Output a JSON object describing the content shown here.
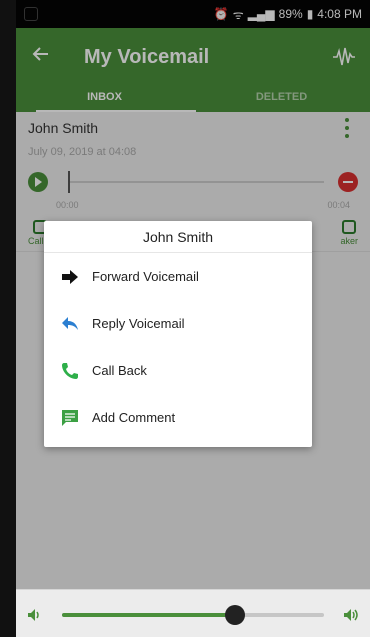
{
  "status_bar": {
    "battery": "89%",
    "time": "4:08 PM"
  },
  "app_bar": {
    "title": "My Voicemail",
    "back_icon": "arrow-left-icon",
    "action_icon": "waveform-icon"
  },
  "tabs": [
    {
      "label": "INBOX",
      "active": true
    },
    {
      "label": "DELETED",
      "active": false
    }
  ],
  "voicemail": {
    "caller": "John Smith",
    "date": "July 09, 2019 at 04:08",
    "time_start": "00:00",
    "time_end": "00:04",
    "actions": [
      {
        "label": "Call B",
        "icon": "phone-icon"
      },
      {
        "label": "aker",
        "icon": "speaker-icon"
      }
    ]
  },
  "dialog": {
    "title": "John Smith",
    "items": [
      {
        "label": "Forward Voicemail",
        "icon": "forward-arrow-icon",
        "color": "#111111"
      },
      {
        "label": "Reply Voicemail",
        "icon": "reply-icon",
        "color": "#2b7fd1"
      },
      {
        "label": "Call Back",
        "icon": "phone-icon",
        "color": "#2eaf4a"
      },
      {
        "label": "Add Comment",
        "icon": "comment-icon",
        "color": "#3ca044"
      }
    ]
  },
  "volume": {
    "level": 0.66,
    "left_icon": "volume-low-icon",
    "right_icon": "volume-high-icon"
  },
  "colors": {
    "primary": "#4a8f3b",
    "delete": "#d93030"
  }
}
